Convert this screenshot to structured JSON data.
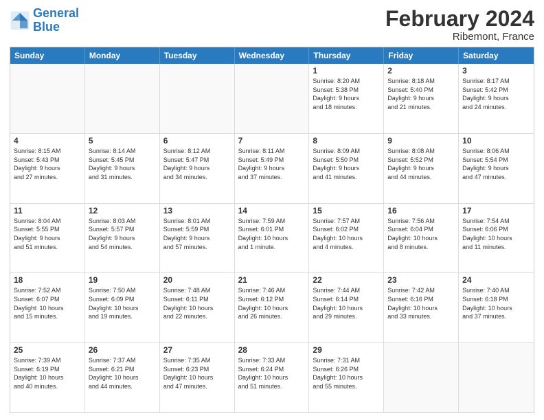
{
  "header": {
    "logo_line1": "General",
    "logo_line2": "Blue",
    "month_title": "February 2024",
    "location": "Ribemont, France"
  },
  "days_of_week": [
    "Sunday",
    "Monday",
    "Tuesday",
    "Wednesday",
    "Thursday",
    "Friday",
    "Saturday"
  ],
  "weeks": [
    [
      {
        "day": "",
        "info": "",
        "empty": true
      },
      {
        "day": "",
        "info": "",
        "empty": true
      },
      {
        "day": "",
        "info": "",
        "empty": true
      },
      {
        "day": "",
        "info": "",
        "empty": true
      },
      {
        "day": "1",
        "info": "Sunrise: 8:20 AM\nSunset: 5:38 PM\nDaylight: 9 hours\nand 18 minutes."
      },
      {
        "day": "2",
        "info": "Sunrise: 8:18 AM\nSunset: 5:40 PM\nDaylight: 9 hours\nand 21 minutes."
      },
      {
        "day": "3",
        "info": "Sunrise: 8:17 AM\nSunset: 5:42 PM\nDaylight: 9 hours\nand 24 minutes."
      }
    ],
    [
      {
        "day": "4",
        "info": "Sunrise: 8:15 AM\nSunset: 5:43 PM\nDaylight: 9 hours\nand 27 minutes."
      },
      {
        "day": "5",
        "info": "Sunrise: 8:14 AM\nSunset: 5:45 PM\nDaylight: 9 hours\nand 31 minutes."
      },
      {
        "day": "6",
        "info": "Sunrise: 8:12 AM\nSunset: 5:47 PM\nDaylight: 9 hours\nand 34 minutes."
      },
      {
        "day": "7",
        "info": "Sunrise: 8:11 AM\nSunset: 5:49 PM\nDaylight: 9 hours\nand 37 minutes."
      },
      {
        "day": "8",
        "info": "Sunrise: 8:09 AM\nSunset: 5:50 PM\nDaylight: 9 hours\nand 41 minutes."
      },
      {
        "day": "9",
        "info": "Sunrise: 8:08 AM\nSunset: 5:52 PM\nDaylight: 9 hours\nand 44 minutes."
      },
      {
        "day": "10",
        "info": "Sunrise: 8:06 AM\nSunset: 5:54 PM\nDaylight: 9 hours\nand 47 minutes."
      }
    ],
    [
      {
        "day": "11",
        "info": "Sunrise: 8:04 AM\nSunset: 5:55 PM\nDaylight: 9 hours\nand 51 minutes."
      },
      {
        "day": "12",
        "info": "Sunrise: 8:03 AM\nSunset: 5:57 PM\nDaylight: 9 hours\nand 54 minutes."
      },
      {
        "day": "13",
        "info": "Sunrise: 8:01 AM\nSunset: 5:59 PM\nDaylight: 9 hours\nand 57 minutes."
      },
      {
        "day": "14",
        "info": "Sunrise: 7:59 AM\nSunset: 6:01 PM\nDaylight: 10 hours\nand 1 minute."
      },
      {
        "day": "15",
        "info": "Sunrise: 7:57 AM\nSunset: 6:02 PM\nDaylight: 10 hours\nand 4 minutes."
      },
      {
        "day": "16",
        "info": "Sunrise: 7:56 AM\nSunset: 6:04 PM\nDaylight: 10 hours\nand 8 minutes."
      },
      {
        "day": "17",
        "info": "Sunrise: 7:54 AM\nSunset: 6:06 PM\nDaylight: 10 hours\nand 11 minutes."
      }
    ],
    [
      {
        "day": "18",
        "info": "Sunrise: 7:52 AM\nSunset: 6:07 PM\nDaylight: 10 hours\nand 15 minutes."
      },
      {
        "day": "19",
        "info": "Sunrise: 7:50 AM\nSunset: 6:09 PM\nDaylight: 10 hours\nand 19 minutes."
      },
      {
        "day": "20",
        "info": "Sunrise: 7:48 AM\nSunset: 6:11 PM\nDaylight: 10 hours\nand 22 minutes."
      },
      {
        "day": "21",
        "info": "Sunrise: 7:46 AM\nSunset: 6:12 PM\nDaylight: 10 hours\nand 26 minutes."
      },
      {
        "day": "22",
        "info": "Sunrise: 7:44 AM\nSunset: 6:14 PM\nDaylight: 10 hours\nand 29 minutes."
      },
      {
        "day": "23",
        "info": "Sunrise: 7:42 AM\nSunset: 6:16 PM\nDaylight: 10 hours\nand 33 minutes."
      },
      {
        "day": "24",
        "info": "Sunrise: 7:40 AM\nSunset: 6:18 PM\nDaylight: 10 hours\nand 37 minutes."
      }
    ],
    [
      {
        "day": "25",
        "info": "Sunrise: 7:39 AM\nSunset: 6:19 PM\nDaylight: 10 hours\nand 40 minutes."
      },
      {
        "day": "26",
        "info": "Sunrise: 7:37 AM\nSunset: 6:21 PM\nDaylight: 10 hours\nand 44 minutes."
      },
      {
        "day": "27",
        "info": "Sunrise: 7:35 AM\nSunset: 6:23 PM\nDaylight: 10 hours\nand 47 minutes."
      },
      {
        "day": "28",
        "info": "Sunrise: 7:33 AM\nSunset: 6:24 PM\nDaylight: 10 hours\nand 51 minutes."
      },
      {
        "day": "29",
        "info": "Sunrise: 7:31 AM\nSunset: 6:26 PM\nDaylight: 10 hours\nand 55 minutes."
      },
      {
        "day": "",
        "info": "",
        "empty": true
      },
      {
        "day": "",
        "info": "",
        "empty": true
      }
    ]
  ]
}
